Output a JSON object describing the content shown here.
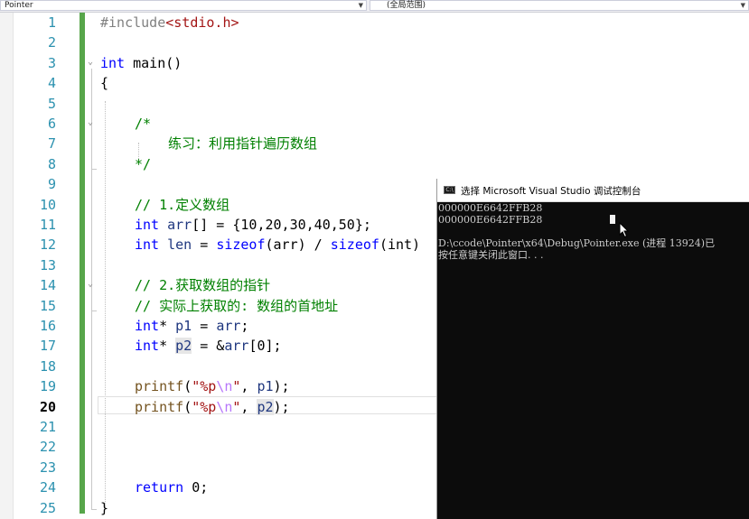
{
  "navbar": {
    "project_dropdown": "Pointer",
    "scope_dropdown": "(全局范围)"
  },
  "editor": {
    "current_line": 20,
    "lines": [
      {
        "no": "1"
      },
      {
        "no": "2"
      },
      {
        "no": "3"
      },
      {
        "no": "4"
      },
      {
        "no": "5"
      },
      {
        "no": "6"
      },
      {
        "no": "7"
      },
      {
        "no": "8"
      },
      {
        "no": "9"
      },
      {
        "no": "10"
      },
      {
        "no": "11"
      },
      {
        "no": "12"
      },
      {
        "no": "13"
      },
      {
        "no": "14"
      },
      {
        "no": "15"
      },
      {
        "no": "16"
      },
      {
        "no": "17"
      },
      {
        "no": "18"
      },
      {
        "no": "19"
      },
      {
        "no": "20"
      },
      {
        "no": "21"
      },
      {
        "no": "22"
      },
      {
        "no": "23"
      },
      {
        "no": "24"
      },
      {
        "no": "25"
      }
    ],
    "code": {
      "l1_directive": "#include",
      "l1_header": "<stdio.h>",
      "l3_type": "int",
      "l3_rest": " main()",
      "l4": "{",
      "l6": "/*",
      "l7": "练习：利用指针遍历数组",
      "l8": "*/",
      "l10": "// 1.定义数组",
      "l11_type": "int",
      "l11_var": "arr",
      "l11_rest": "[] = {10,20,30,40,50};",
      "l12_type": "int",
      "l12_var": "len",
      "l12_eq": " = ",
      "l12_kw1": "sizeof",
      "l12_arg1": "(arr)",
      "l12_div": " / ",
      "l12_kw2": "sizeof",
      "l12_arg2": "(int)",
      "l14": "// 2.获取数组的指针",
      "l15": "// 实际上获取的: 数组的首地址",
      "l16_type": "int",
      "l16_var": "p1",
      "l16_eq": " = ",
      "l16_arr": "arr",
      "l16_end": ";",
      "l17_type": "int",
      "l17_var": "p2",
      "l17_eq": " = &",
      "l17_arr": "arr",
      "l17_end": "[0];",
      "l19_fn": "printf",
      "l19_open": "(",
      "l19_str1": "\"%p",
      "l19_esc": "\\n",
      "l19_str2": "\"",
      "l19_comma": ", ",
      "l19_arg": "p1",
      "l19_end": ");",
      "l20_fn": "printf",
      "l20_open": "(",
      "l20_str1": "\"%p",
      "l20_esc": "\\n",
      "l20_str2": "\"",
      "l20_comma": ", ",
      "l20_arg": "p2",
      "l20_end": ");",
      "l24_kw": "return",
      "l24_rest": " 0;",
      "l25": "}"
    }
  },
  "console": {
    "title": "选择 Microsoft Visual Studio 调试控制台",
    "lines": [
      "000000E6642FFB28",
      "000000E6642FFB28",
      "D:\\ccode\\Pointer\\x64\\Debug\\Pointer.exe (进程 13924)已",
      "按任意键关闭此窗口. . ."
    ]
  },
  "colors": {
    "keyword": "#0000ff",
    "string": "#a31515",
    "comment": "#008000",
    "line_number": "#2b91af",
    "change_bar": "#57a64a",
    "console_bg": "#0c0c0c"
  }
}
